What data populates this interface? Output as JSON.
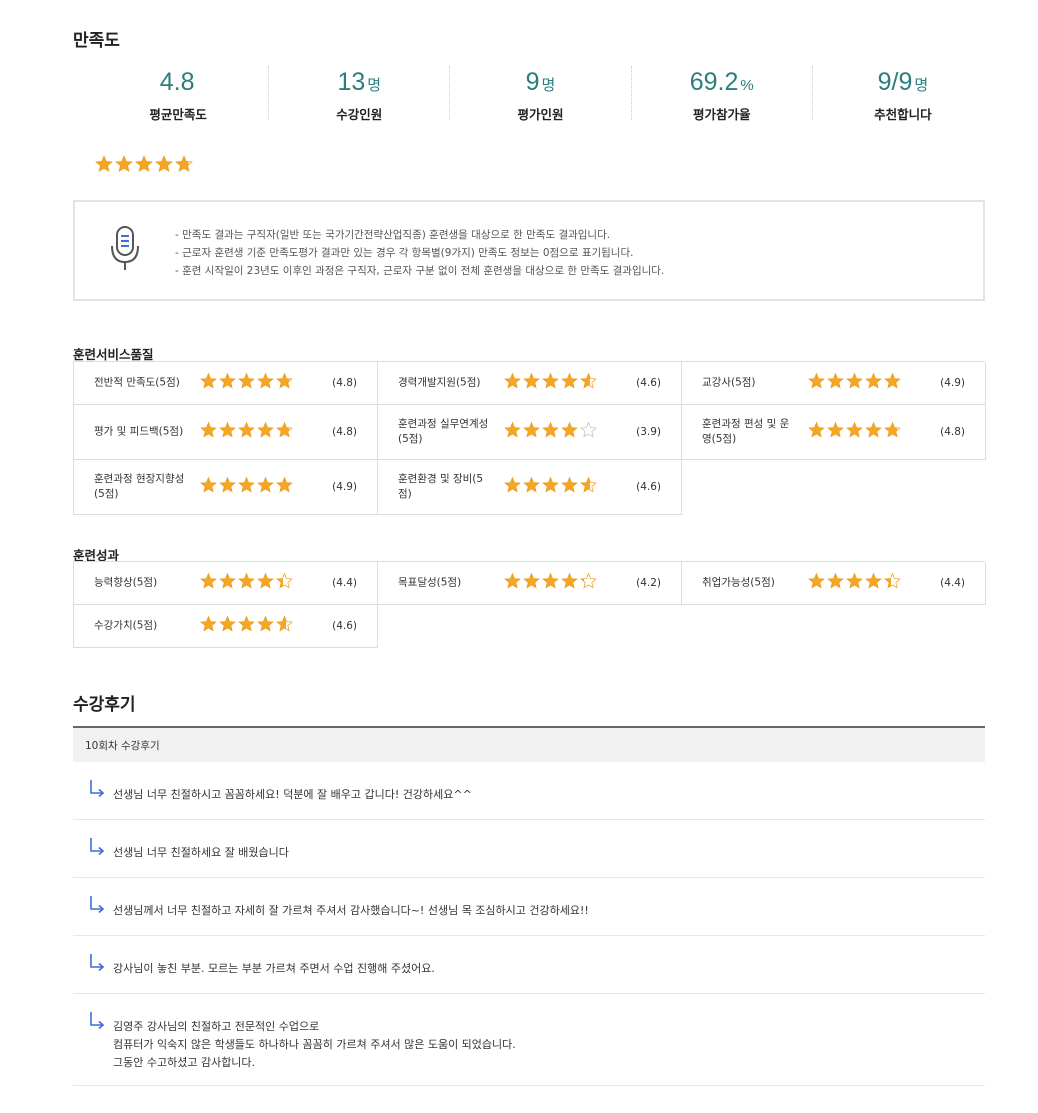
{
  "satisfaction": {
    "title": "만족도",
    "stats": [
      {
        "value": "4.8",
        "unit": "",
        "label": "평균만족도"
      },
      {
        "value": "13",
        "unit": "명",
        "label": "수강인원"
      },
      {
        "value": "9",
        "unit": "명",
        "label": "평가인원"
      },
      {
        "value": "69.2",
        "unit": "%",
        "label": "평가참가율"
      },
      {
        "value": "9/9",
        "unit": "명",
        "label": "추천합니다"
      }
    ],
    "rating": 4.8
  },
  "notice": {
    "icon": "microphone-icon",
    "lines": [
      "- 만족도 결과는 구직자(일반 또는 국가기간전략산업직종) 훈련생을 대상으로 한 만족도 결과입니다.",
      "- 근로자 훈련생 기준 만족도평가 결과만 있는 경우 각 항목별(9가지) 만족도 정보는 0점으로 표기됩니다.",
      "- 훈련 시작일이 23년도 이후인 과정은 구직자, 근로자 구분 없이 전체 훈련생을 대상으로 한 만족도 결과입니다."
    ]
  },
  "service_quality": {
    "title": "훈련서비스품질",
    "items": [
      {
        "label": "전반적 만족도(5점)",
        "rating": 4.8,
        "score": "(4.8)"
      },
      {
        "label": "경력개발지원(5점)",
        "rating": 4.6,
        "score": "(4.6)"
      },
      {
        "label": "교강사(5점)",
        "rating": 4.9,
        "score": "(4.9)"
      },
      {
        "label": "평가 및 피드백(5점)",
        "rating": 4.8,
        "score": "(4.8)"
      },
      {
        "label": "훈련과정 실무연계성(5점)",
        "rating": 3.9,
        "score": "(3.9)"
      },
      {
        "label": "훈련과정 편성 및 운영(5점)",
        "rating": 4.8,
        "score": "(4.8)"
      },
      {
        "label": "훈련과정 현장지향성(5점)",
        "rating": 4.9,
        "score": "(4.9)"
      },
      {
        "label": "훈련환경 및 장비(5점)",
        "rating": 4.6,
        "score": "(4.6)"
      }
    ]
  },
  "outcomes": {
    "title": "훈련성과",
    "items": [
      {
        "label": "능력향상(5점)",
        "rating": 4.4,
        "score": "(4.4)"
      },
      {
        "label": "목표달성(5점)",
        "rating": 4.2,
        "score": "(4.2)"
      },
      {
        "label": "취업가능성(5점)",
        "rating": 4.4,
        "score": "(4.4)"
      },
      {
        "label": "수강가치(5점)",
        "rating": 4.6,
        "score": "(4.6)"
      }
    ]
  },
  "reviews": {
    "title": "수강후기",
    "header": "10회차 수강후기",
    "reply_icon": "reply-arrow-icon",
    "items": [
      [
        "선생님 너무 친절하시고 꼼꼼하세요! 덕분에 잘 배우고 갑니다! 건강하세요^^"
      ],
      [
        "선생님 너무 친절하세요 잘 배웠습니다"
      ],
      [
        "선생님께서 너무 친절하고 자세히 잘 가르쳐 주셔서 감사했습니다~! 선생님 목 조심하시고 건강하세요!!"
      ],
      [
        "강사님이 놓친 부분. 모르는 부분 가르쳐 주면서 수업 진행해 주셨어요."
      ],
      [
        "김영주 강사님의 친절하고 전문적인 수업으로",
        "컴퓨터가 익숙지 않은 학생들도 하나하나 꼼꼼히 가르쳐 주셔서 많은 도움이 되었습니다.",
        "그동안 수고하셨고 감사합니다."
      ]
    ]
  },
  "colors": {
    "accent": "#2a7f7c",
    "star": "#f5a623",
    "star_empty": "#d8d8d8",
    "reply": "#3a6fd8"
  }
}
